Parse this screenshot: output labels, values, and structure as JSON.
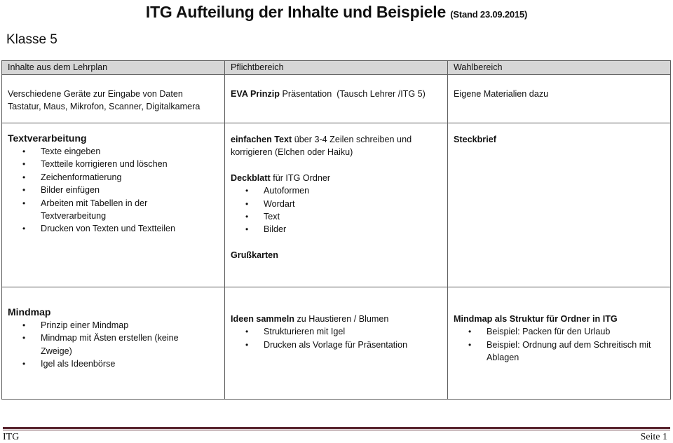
{
  "document": {
    "title": "ITG Aufteilung der Inhalte und Beispiele",
    "stand": "(Stand 23.09.2015)",
    "klasse": "Klasse 5"
  },
  "table": {
    "headers": [
      "Inhalte aus dem Lehrplan",
      "Pflichtbereich",
      "Wahlbereich"
    ],
    "rows": [
      {
        "lehrplan": {
          "line1": "Verschiedene Geräte zur Eingabe von Daten",
          "line2": "Tastatur, Maus, Mikrofon, Scanner, Digitalkamera"
        },
        "pflicht": {
          "bold": "EVA Prinzip",
          "text": " Präsentation  (Tausch Lehrer /ITG 5)"
        },
        "wahl": {
          "text": "Eigene Materialien dazu"
        }
      },
      {
        "lehrplan": {
          "title": "Textverarbeitung",
          "items": [
            "Texte eingeben",
            "Textteile korrigieren und löschen",
            "Zeichenformatierung",
            "Bilder einfügen",
            "Arbeiten mit Tabellen in der Textverarbeitung",
            "Drucken von Texten und Textteilen"
          ]
        },
        "pflicht": {
          "p1_bold": "einfachen Text",
          "p1_text": " über 3-4 Zeilen schreiben und korrigieren (Elchen oder Haiku)",
          "p2_bold": "Deckblatt",
          "p2_text": " für ITG Ordner",
          "p2_items": [
            "Autoformen",
            "Wordart",
            "Text",
            "Bilder"
          ],
          "p3_bold": "Grußkarten"
        },
        "wahl": {
          "bold": "Steckbrief"
        }
      },
      {
        "lehrplan": {
          "title": "Mindmap",
          "items": [
            "Prinzip einer Mindmap",
            "Mindmap mit Ästen erstellen (keine Zweige)",
            "Igel als Ideenbörse"
          ]
        },
        "pflicht": {
          "bold": "Ideen sammeln",
          "text": " zu Haustieren / Blumen",
          "items": [
            "Strukturieren mit Igel",
            "Drucken als Vorlage für Präsentation"
          ]
        },
        "wahl": {
          "bold": "Mindmap als Struktur für Ordner in ITG",
          "items": [
            "Beispiel: Packen für den Urlaub",
            "Beispiel: Ordnung auf dem Schreitisch mit Ablagen"
          ]
        }
      }
    ]
  },
  "footer": {
    "left": "ITG",
    "right": "Seite 1",
    "line_color": "#5a2630"
  },
  "bullet_glyph": "•",
  "colors": {
    "header_bg": "#d6d6d6",
    "border": "#5e5e5e"
  }
}
